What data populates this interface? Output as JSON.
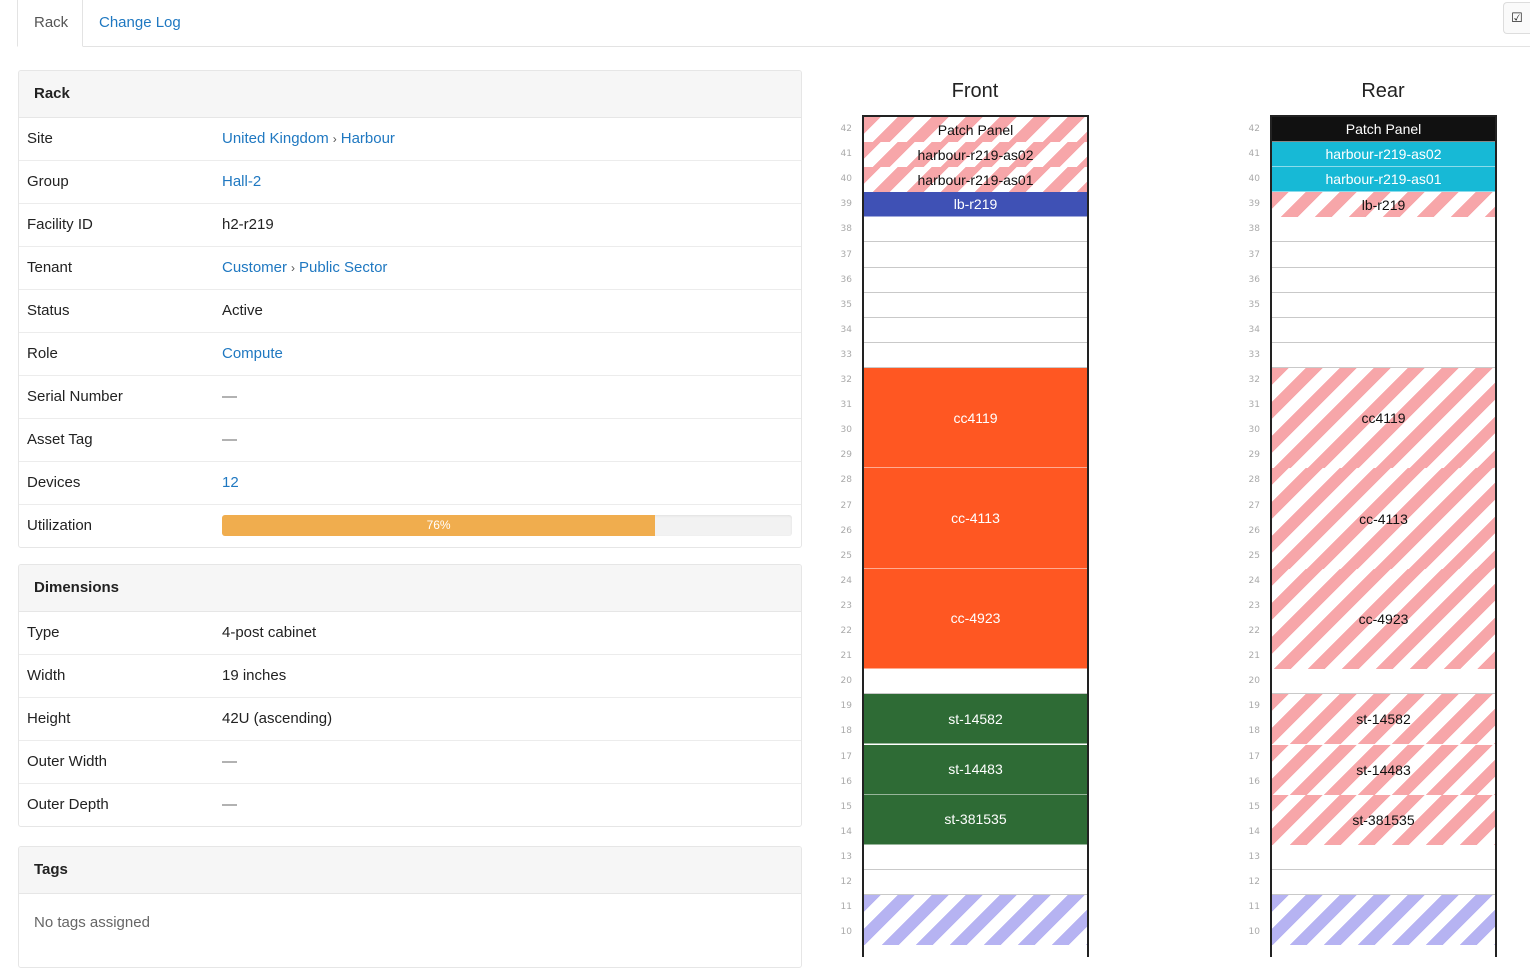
{
  "tabs": {
    "rack": "Rack",
    "changelog": "Change Log"
  },
  "corner_icon": "edit-check-icon",
  "rack_panel": {
    "title": "Rack",
    "site_label": "Site",
    "site_region": "United Kingdom",
    "site_sep": "›",
    "site_name": "Harbour",
    "group_label": "Group",
    "group_value": "Hall-2",
    "facility_label": "Facility ID",
    "facility_value": "h2-r219",
    "tenant_label": "Tenant",
    "tenant_group": "Customer",
    "tenant_sep": "›",
    "tenant_value": "Public Sector",
    "status_label": "Status",
    "status_value": "Active",
    "role_label": "Role",
    "role_value": "Compute",
    "serial_label": "Serial Number",
    "serial_value": "—",
    "asset_label": "Asset Tag",
    "asset_value": "—",
    "devices_label": "Devices",
    "devices_value": "12",
    "util_label": "Utilization",
    "util_text": "76%",
    "util_fraction": 0.76
  },
  "dimensions_panel": {
    "title": "Dimensions",
    "rows": [
      {
        "label": "Type",
        "value": "4-post cabinet"
      },
      {
        "label": "Width",
        "value": "19 inches"
      },
      {
        "label": "Height",
        "value": "42U (ascending)"
      },
      {
        "label": "Outer Width",
        "value": "—"
      },
      {
        "label": "Outer Depth",
        "value": "—"
      }
    ]
  },
  "tags_panel": {
    "title": "Tags",
    "empty_text": "No tags assigned"
  },
  "elevations": {
    "unit_numbers": [
      42,
      41,
      40,
      39,
      38,
      37,
      36,
      35,
      34,
      33,
      32,
      31,
      30,
      29,
      28,
      27,
      26,
      25,
      24,
      23,
      22,
      21,
      20,
      19,
      18,
      17,
      16,
      15,
      14,
      13,
      12,
      11,
      10
    ],
    "front": {
      "title": "Front",
      "devices": [
        {
          "name": "Patch Panel",
          "top_u": 42,
          "height_u": 1,
          "style": "stripe-red"
        },
        {
          "name": "harbour-r219-as02",
          "top_u": 41,
          "height_u": 1,
          "style": "stripe-red"
        },
        {
          "name": "harbour-r219-as01",
          "top_u": 40,
          "height_u": 1,
          "style": "stripe-red"
        },
        {
          "name": "lb-r219",
          "top_u": 39,
          "height_u": 1,
          "style": "solid",
          "color": "#3f51b5"
        },
        {
          "name": "cc4119",
          "top_u": 32,
          "height_u": 4,
          "style": "solid",
          "color": "#ff5722"
        },
        {
          "name": "cc-4113",
          "top_u": 28,
          "height_u": 4,
          "style": "solid",
          "color": "#ff5722"
        },
        {
          "name": "cc-4923",
          "top_u": 24,
          "height_u": 4,
          "style": "solid",
          "color": "#ff5722"
        },
        {
          "name": "st-14582",
          "top_u": 19,
          "height_u": 2,
          "style": "solid",
          "color": "#2e6b35"
        },
        {
          "name": "st-14483",
          "top_u": 17,
          "height_u": 2,
          "style": "solid",
          "color": "#2e6b35"
        },
        {
          "name": "st-381535",
          "top_u": 15,
          "height_u": 2,
          "style": "solid",
          "color": "#2e6b35"
        },
        {
          "name": "",
          "top_u": 11,
          "height_u": 2,
          "style": "stripe-blue"
        }
      ]
    },
    "rear": {
      "title": "Rear",
      "devices": [
        {
          "name": "Patch Panel",
          "top_u": 42,
          "height_u": 1,
          "style": "solid",
          "color": "#111111"
        },
        {
          "name": "harbour-r219-as02",
          "top_u": 41,
          "height_u": 1,
          "style": "solid",
          "color": "#17b9d6"
        },
        {
          "name": "harbour-r219-as01",
          "top_u": 40,
          "height_u": 1,
          "style": "solid",
          "color": "#17b9d6"
        },
        {
          "name": "lb-r219",
          "top_u": 39,
          "height_u": 1,
          "style": "stripe-red"
        },
        {
          "name": "cc4119",
          "top_u": 32,
          "height_u": 4,
          "style": "stripe-red"
        },
        {
          "name": "cc-4113",
          "top_u": 28,
          "height_u": 4,
          "style": "stripe-red"
        },
        {
          "name": "cc-4923",
          "top_u": 24,
          "height_u": 4,
          "style": "stripe-red"
        },
        {
          "name": "st-14582",
          "top_u": 19,
          "height_u": 2,
          "style": "stripe-red"
        },
        {
          "name": "st-14483",
          "top_u": 17,
          "height_u": 2,
          "style": "stripe-red"
        },
        {
          "name": "st-381535",
          "top_u": 15,
          "height_u": 2,
          "style": "stripe-red"
        },
        {
          "name": "",
          "top_u": 11,
          "height_u": 2,
          "style": "stripe-blue"
        }
      ]
    }
  }
}
